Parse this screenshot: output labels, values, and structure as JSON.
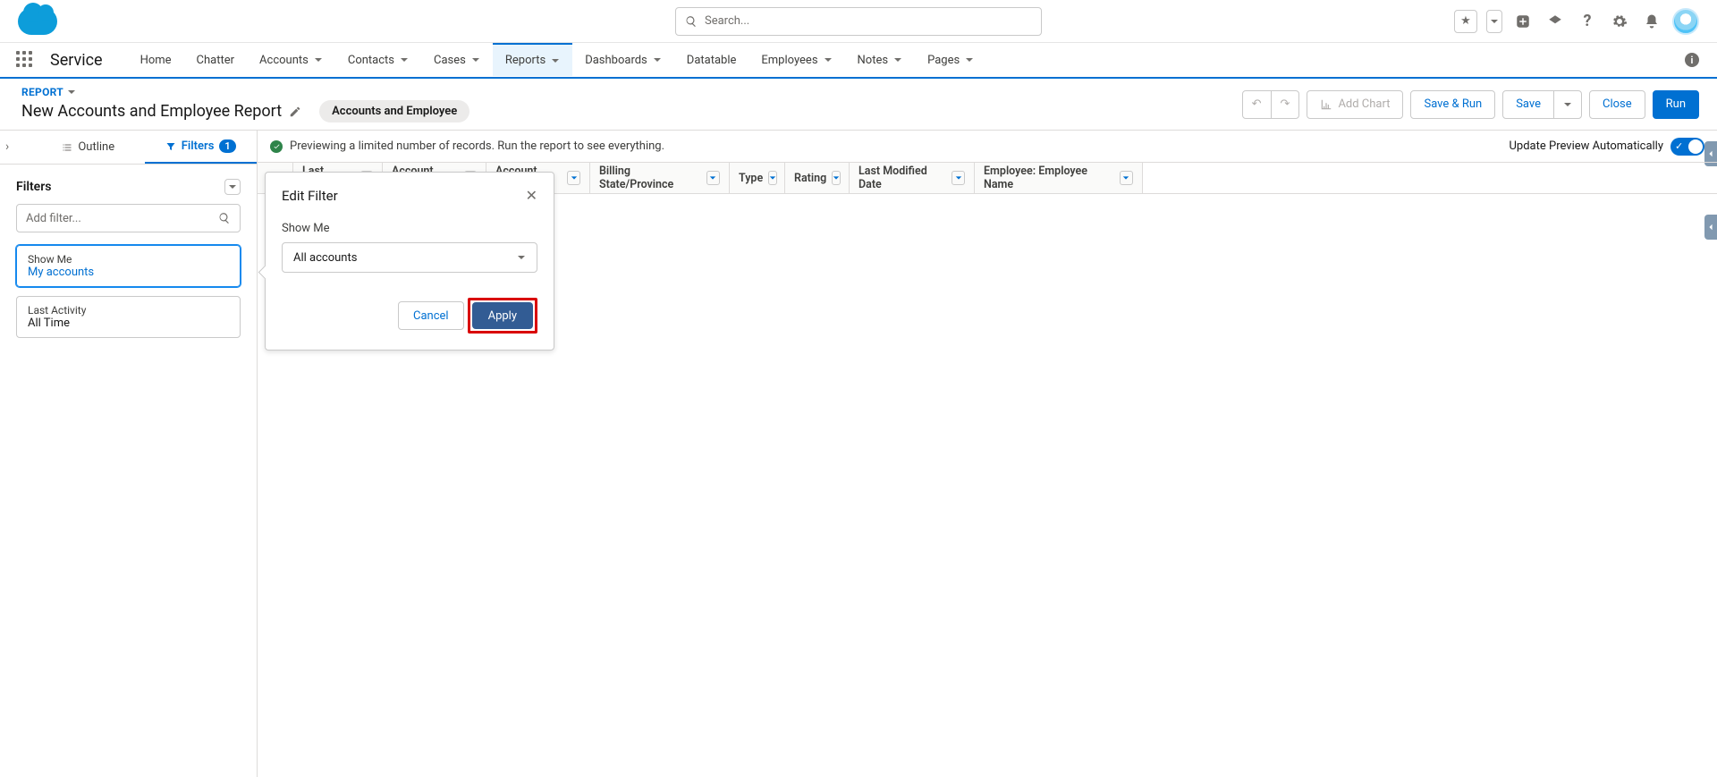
{
  "search": {
    "placeholder": "Search..."
  },
  "appName": "Service",
  "nav": {
    "home": "Home",
    "chatter": "Chatter",
    "accounts": "Accounts",
    "contacts": "Contacts",
    "cases": "Cases",
    "reports": "Reports",
    "dashboards": "Dashboards",
    "datatable": "Datatable",
    "employees": "Employees",
    "notes": "Notes",
    "pages": "Pages"
  },
  "subhead": {
    "objectLabel": "REPORT",
    "title": "New Accounts and Employee Report",
    "pill": "Accounts and Employee",
    "addChart": "Add Chart",
    "saveRun": "Save & Run",
    "save": "Save",
    "close": "Close",
    "run": "Run"
  },
  "tabs": {
    "outline": "Outline",
    "filters": "Filters",
    "filterCount": "1"
  },
  "filtersPanel": {
    "heading": "Filters",
    "addPlaceholder": "Add filter...",
    "card1Label": "Show Me",
    "card1Value": "My accounts",
    "card2Label": "Last Activity",
    "card2Value": "All Time"
  },
  "preview": {
    "message": "Previewing a limited number of records. Run the report to see everything.",
    "autoLabel": "Update Preview Automatically"
  },
  "columns": {
    "lastActivity": "Last Activity",
    "accountOwner": "Account Owner",
    "accountName": "Account Name",
    "billingState": "Billing State/Province",
    "type": "Type",
    "rating": "Rating",
    "lastModified": "Last Modified Date",
    "employeeName": "Employee: Employee Name"
  },
  "popover": {
    "title": "Edit Filter",
    "fieldLabel": "Show Me",
    "selectValue": "All accounts",
    "cancel": "Cancel",
    "apply": "Apply"
  }
}
